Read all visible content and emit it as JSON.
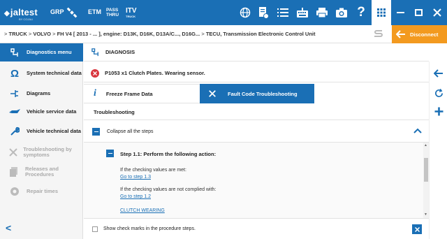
{
  "topbar": {
    "logo": "jaltest",
    "logo_sub": "BY COJALI",
    "grp": "GRP",
    "etm": "ETM",
    "pass": "PASS",
    "thru": "THRU",
    "itv": "ITV",
    "itv_sub": "TRUCK"
  },
  "breadcrumb": {
    "sep": ">",
    "truck": "TRUCK",
    "volvo": "VOLVO",
    "model": "FH V4 [ 2013 - ... ], engine: D13K, D16K, D13A/C..., D16G...",
    "ecu": "TECU, Transmission Electronic Control Unit",
    "disconnect": "Disconnect"
  },
  "sidebar": {
    "items": [
      {
        "label": "Diagnostics menu",
        "icon": "diagnostics-icon"
      },
      {
        "label": "System technical data",
        "icon": "omega-icon"
      },
      {
        "label": "Diagrams",
        "icon": "diagram-icon"
      },
      {
        "label": "Vehicle service data",
        "icon": "oil-can-icon"
      },
      {
        "label": "Vehicle technical data",
        "icon": "wrench-icon"
      },
      {
        "label": "Troubleshooting by symptoms",
        "icon": "tools-icon"
      },
      {
        "label": "Releases and Procedures",
        "icon": "documents-icon"
      },
      {
        "label": "Repair times",
        "icon": "gear-clock-icon"
      }
    ],
    "back": "<"
  },
  "main": {
    "diagnosis_title": "DIAGNOSIS",
    "fault": "P1053  x1  Clutch Plates. Wearing sensor.",
    "tabs": {
      "freeze": "Freeze Frame Data",
      "troubleshooting": "Fault Code Troubleshooting"
    },
    "section_title": "Troubleshooting",
    "collapse": "Collapse all the steps",
    "step_title": "Step 1.1: Perform the following action:",
    "met_text": "If the checking values are met:",
    "met_link": "Go to step 1.3",
    "not_met_text": "If the checking values are not complied with:",
    "not_met_link": "Go to step 1.2",
    "clutch_link": "CLUTCH WEARING",
    "show_marks": "Show check marks in the procedure steps."
  },
  "colors": {
    "brand_blue": "#1a6fb5",
    "disconnect_orange": "#f39a1f",
    "error_red": "#d9363e"
  }
}
